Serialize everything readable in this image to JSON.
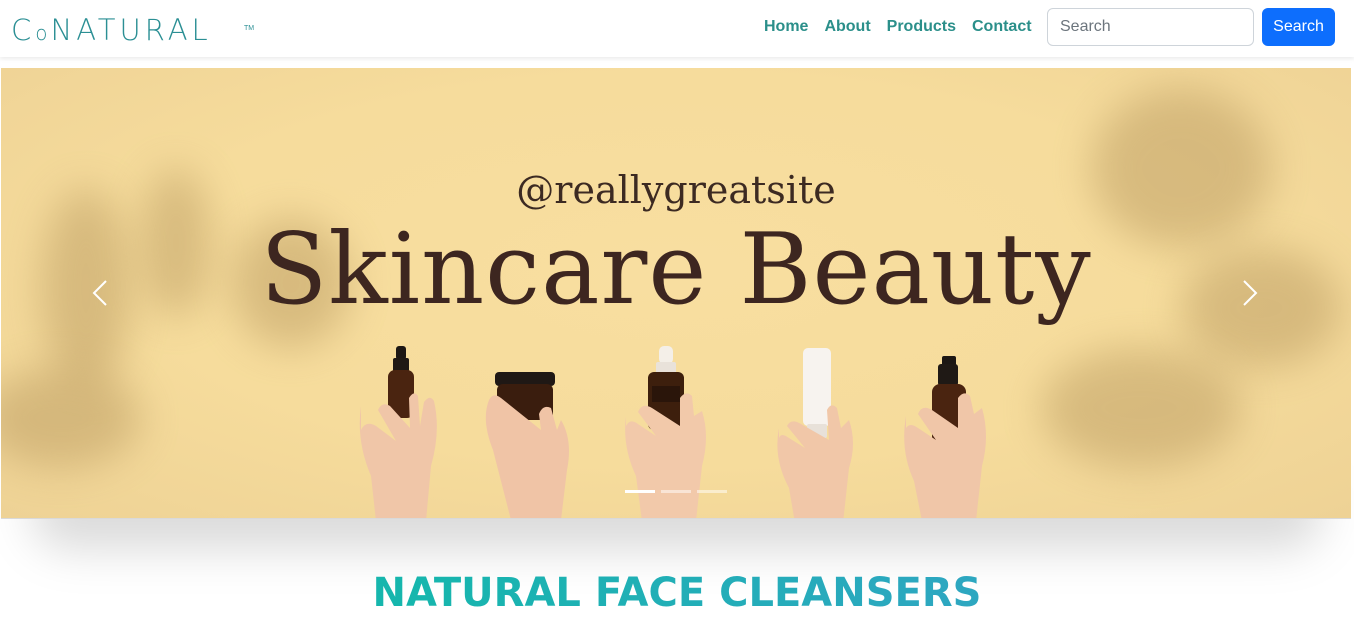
{
  "header": {
    "brand": "CoNATURAL",
    "trademark": "TM",
    "nav": [
      "Home",
      "About",
      "Products",
      "Contact"
    ],
    "search": {
      "placeholder": "Search",
      "button_label": "Search"
    }
  },
  "hero": {
    "handle": "@reallygreatsite",
    "headline": "Skincare Beauty",
    "slide_count": 3,
    "active_slide": 1,
    "prev_icon": "chevron-left-icon",
    "next_icon": "chevron-right-icon"
  },
  "section": {
    "title": "NATURAL FACE CLEANSERS"
  },
  "colors": {
    "brand": "#2b8f94",
    "primary_button": "#0d6efd",
    "hero_background": "#f6dc9c",
    "headline": "#3d2620",
    "section_title": "#1fb5ad"
  }
}
